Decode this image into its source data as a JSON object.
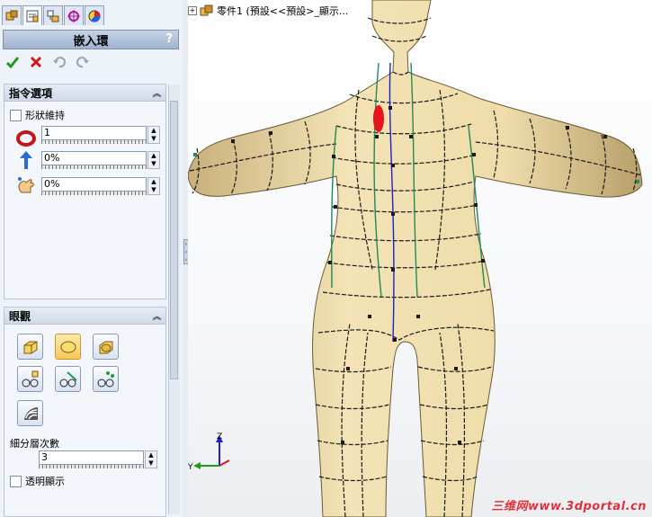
{
  "tabs": [
    {
      "name": "feature-manager-tab",
      "icon": "feature-tree-icon"
    },
    {
      "name": "property-manager-tab",
      "icon": "property-manager-icon"
    },
    {
      "name": "configuration-manager-tab",
      "icon": "configuration-icon"
    },
    {
      "name": "dimxpert-tab",
      "icon": "crosshair-icon"
    },
    {
      "name": "display-manager-tab",
      "icon": "appearance-icon"
    }
  ],
  "property_manager": {
    "title": "嵌入環",
    "help": "?",
    "actions": [
      "ok-icon",
      "cancel-icon",
      "undo-icon",
      "redo-icon"
    ]
  },
  "options_group": {
    "title": "指令選項",
    "keep_shape_label": "形狀維持",
    "loops_value": "1",
    "direction_value": "0%",
    "offset_value": "0%"
  },
  "display_group": {
    "title": "眼觀",
    "subdivision_label": "細分層次數",
    "subdivision_value": "3",
    "transparent_label": "透明顯示"
  },
  "viewport": {
    "tree_label": "零件1  (預設<<預設>_顯示...",
    "watermark": "三维网www.3dportal.cn",
    "axis_y": "Y",
    "axis_z": "Z",
    "colors": {
      "model": "#f0dfae",
      "curve_green": "#1f8a5a",
      "curve_blue": "#2121c8",
      "highlight": "#e8141c"
    }
  }
}
